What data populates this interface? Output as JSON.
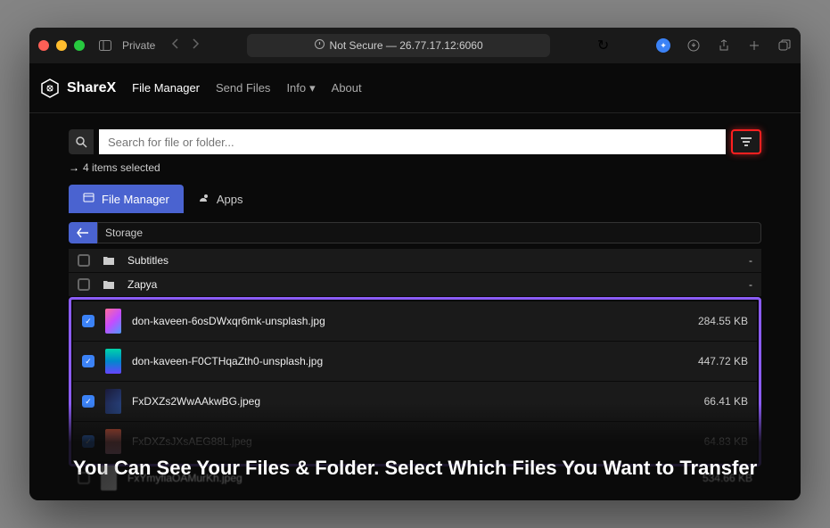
{
  "browser": {
    "private_label": "Private",
    "address": "Not Secure — 26.77.17.12:6060"
  },
  "app": {
    "name": "ShareX",
    "nav": {
      "file_manager": "File Manager",
      "send_files": "Send Files",
      "info": "Info",
      "about": "About"
    }
  },
  "search": {
    "placeholder": "Search for file or folder..."
  },
  "selection_status": "4 items selected",
  "tabs": {
    "file_manager": "File Manager",
    "apps": "Apps"
  },
  "path": "Storage",
  "folders": [
    {
      "name": "Subtitles",
      "size": "-"
    },
    {
      "name": "Zapya",
      "size": "-"
    }
  ],
  "files": [
    {
      "name": "don-kaveen-6osDWxqr6mk-unsplash.jpg",
      "size": "284.55 KB"
    },
    {
      "name": "don-kaveen-F0CTHqaZth0-unsplash.jpg",
      "size": "447.72 KB"
    },
    {
      "name": "FxDXZs2WwAAkwBG.jpeg",
      "size": "66.41 KB"
    },
    {
      "name": "FxDXZsJXsAEG88L.jpeg",
      "size": "64.83 KB"
    }
  ],
  "headline": "You Can See Your Files & Folder. Select Which Files You Want to Transfer",
  "faded_file": {
    "name": "FxYmyfiaOAMurKh.jpeg",
    "size": "534.66 KB"
  }
}
